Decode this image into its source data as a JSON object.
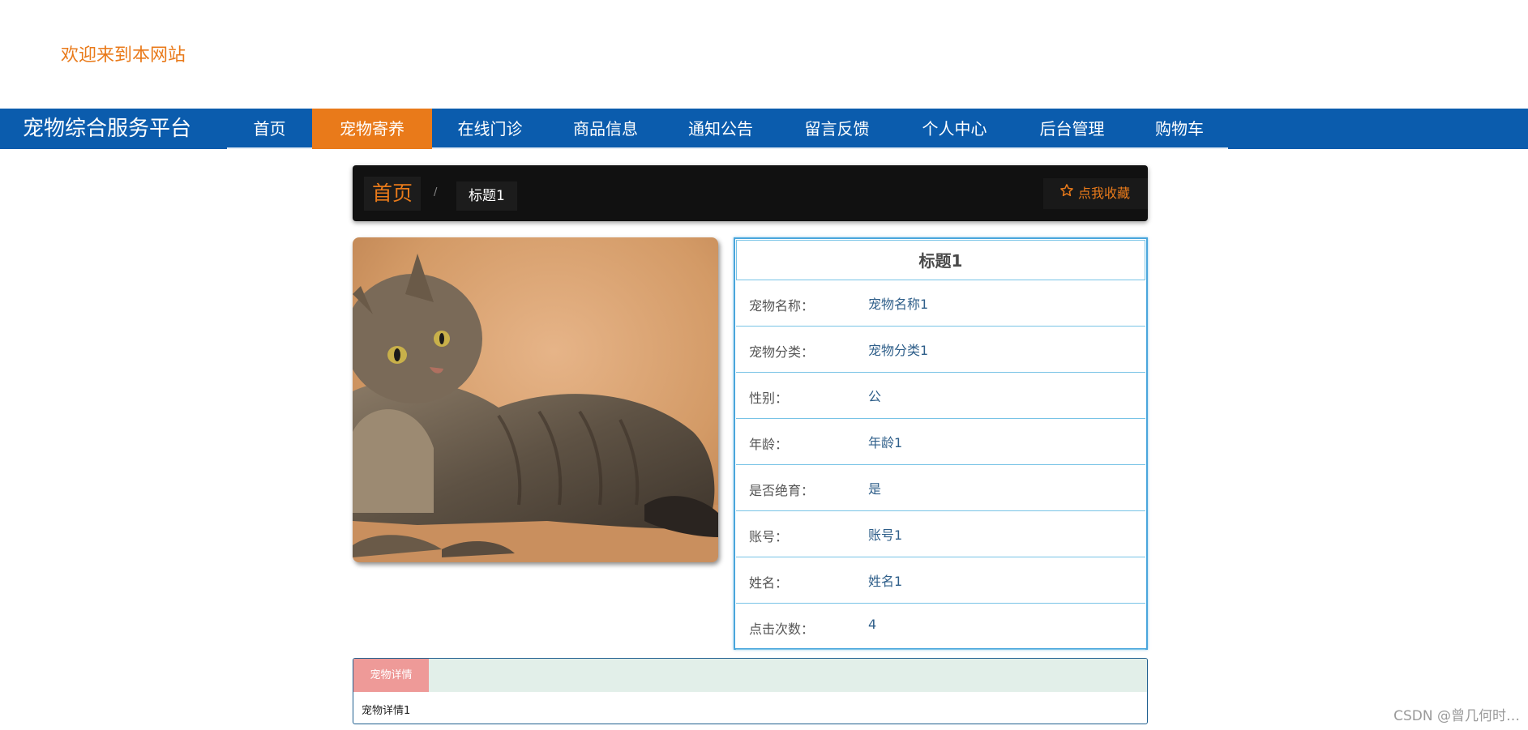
{
  "header": {
    "welcome": "欢迎来到本网站"
  },
  "nav": {
    "brand": "宠物综合服务平台",
    "items": [
      {
        "label": "首页"
      },
      {
        "label": "宠物寄养"
      },
      {
        "label": "在线门诊"
      },
      {
        "label": "商品信息"
      },
      {
        "label": "通知公告"
      },
      {
        "label": "留言反馈"
      },
      {
        "label": "个人中心"
      },
      {
        "label": "后台管理"
      },
      {
        "label": "购物车"
      }
    ],
    "active_index": 1
  },
  "breadcrumb": {
    "home": "首页",
    "separator": "/",
    "current": "标题1",
    "favorite": "点我收藏"
  },
  "info": {
    "title": "标题1",
    "rows": [
      {
        "label": "宠物名称：",
        "value": "宠物名称1"
      },
      {
        "label": "宠物分类：",
        "value": "宠物分类1"
      },
      {
        "label": "性别：",
        "value": "公"
      },
      {
        "label": "年龄：",
        "value": "年龄1"
      },
      {
        "label": "是否绝育：",
        "value": "是"
      },
      {
        "label": "账号：",
        "value": "账号1"
      },
      {
        "label": "姓名：",
        "value": "姓名1"
      },
      {
        "label": "点击次数：",
        "value": "4"
      }
    ]
  },
  "detail": {
    "tab": "宠物详情",
    "content": "宠物详情1"
  },
  "watermark": "CSDN @曾几何时…",
  "colors": {
    "accent": "#e97a1a",
    "nav_bg": "#0b5cad",
    "border_blue": "#4aa6dc"
  }
}
